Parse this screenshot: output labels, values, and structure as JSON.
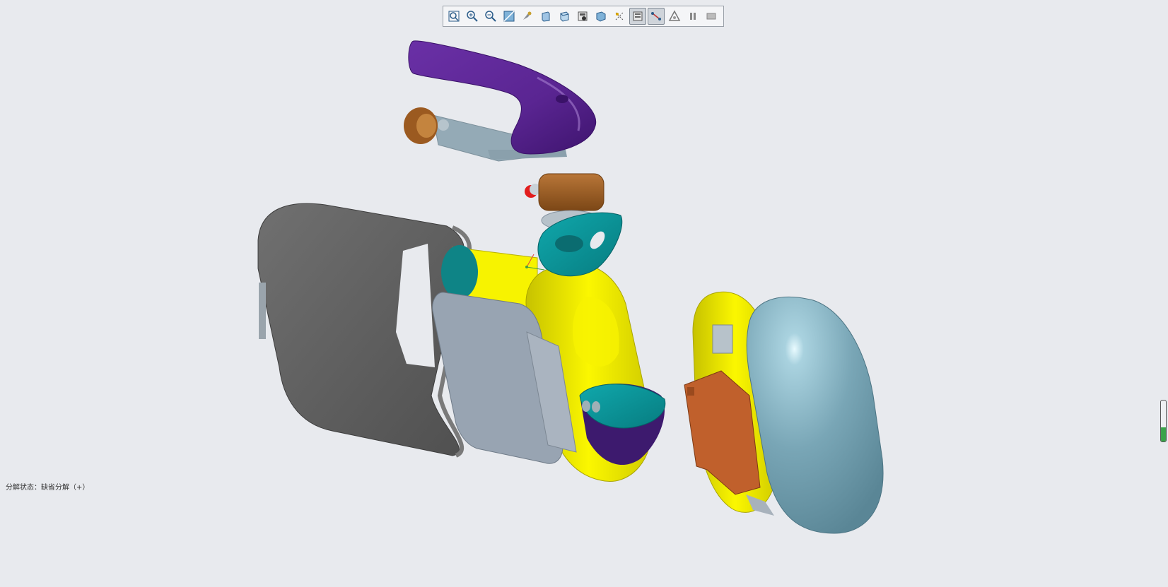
{
  "toolbar": {
    "buttons": [
      {
        "icon": "zoom-to-fit-icon",
        "active": false
      },
      {
        "icon": "zoom-in-icon",
        "active": false
      },
      {
        "icon": "zoom-out-icon",
        "active": false
      },
      {
        "icon": "view-normal-icon",
        "active": false
      },
      {
        "icon": "reorient-icon",
        "active": false
      },
      {
        "icon": "saved-views-icon",
        "active": false
      },
      {
        "icon": "display-style-icon",
        "active": false
      },
      {
        "icon": "view-manager-icon",
        "active": false
      },
      {
        "icon": "perspective-view-icon",
        "active": false
      },
      {
        "icon": "datum-display-icon",
        "active": false
      },
      {
        "icon": "explode-view-icon",
        "active": true
      },
      {
        "icon": "explode-lines-icon",
        "active": true
      },
      {
        "icon": "annotation-display-icon",
        "active": false
      },
      {
        "icon": "pause-icon",
        "active": false
      },
      {
        "icon": "repaint-icon",
        "active": false
      }
    ]
  },
  "status": {
    "text": "分解状态：缺省分解（+）"
  },
  "model_parts": [
    {
      "name": "purple-handle",
      "color": "#5a2a90"
    },
    {
      "name": "gray-cover",
      "color": "#5e5e5e"
    },
    {
      "name": "yellow-frame",
      "color": "#f0ec00"
    },
    {
      "name": "teal-cap",
      "color": "#0aa0a4"
    },
    {
      "name": "light-blue-shell",
      "color": "#7fa9b8"
    },
    {
      "name": "orange-bracket",
      "color": "#c0602c"
    },
    {
      "name": "brown-button",
      "color": "#9b5a20"
    }
  ],
  "side_indicator": {
    "level": 0.35,
    "color": "#3aa34a"
  }
}
